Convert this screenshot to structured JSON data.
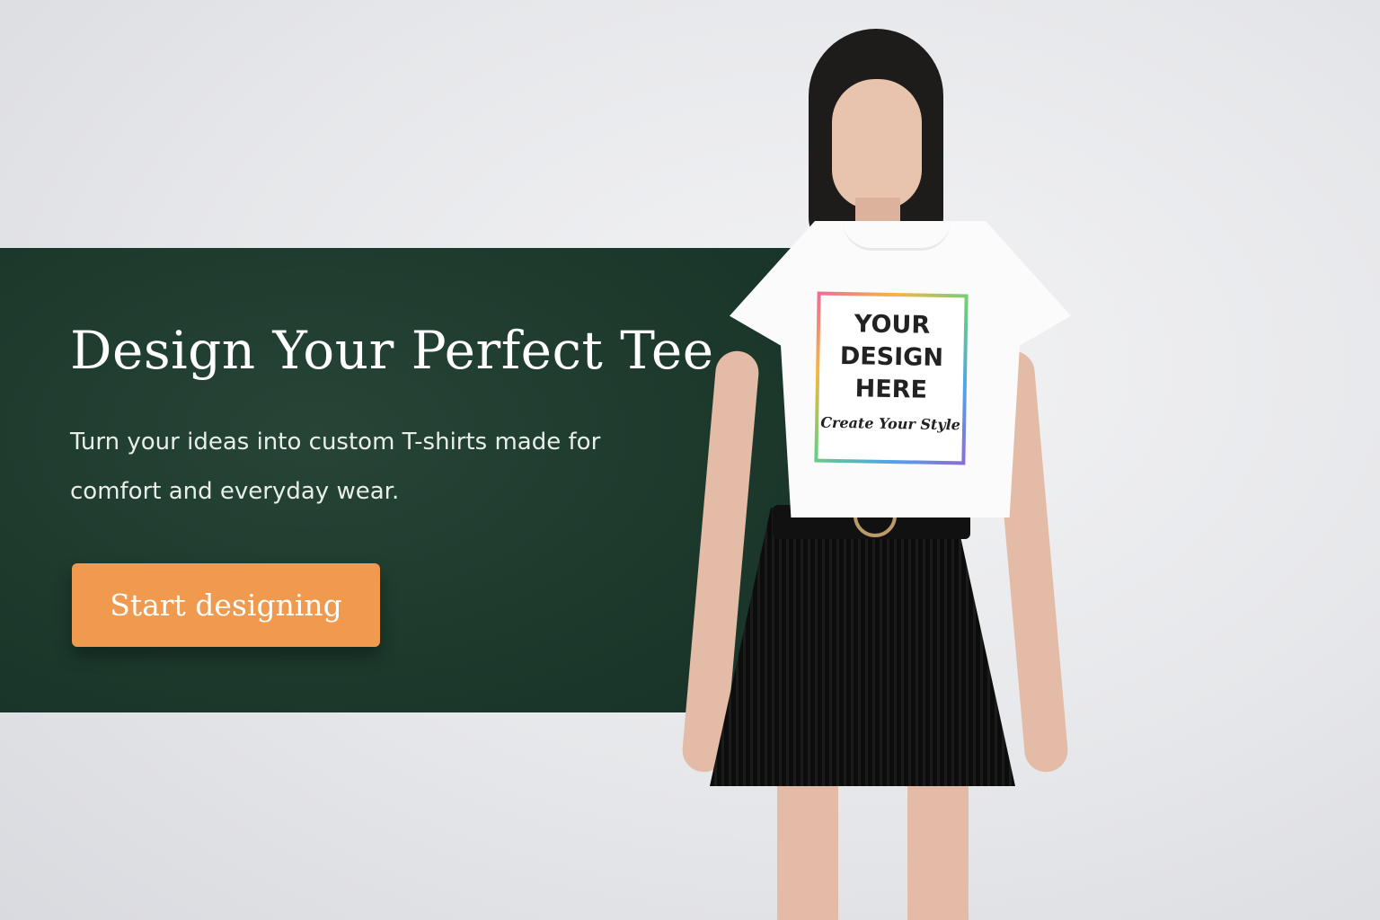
{
  "hero": {
    "headline": "Design Your Perfect Tee",
    "subtext": "Turn your ideas into custom T-shirts made for comfort and everyday wear.",
    "cta_label": "Start designing"
  },
  "shirt_print": {
    "line1": "YOUR",
    "line2": "DESIGN",
    "line3": "HERE",
    "tagline": "Create Your Style"
  },
  "colors": {
    "panel": "#1d3a2d",
    "cta": "#ef9a4f",
    "text": "#ffffff"
  }
}
